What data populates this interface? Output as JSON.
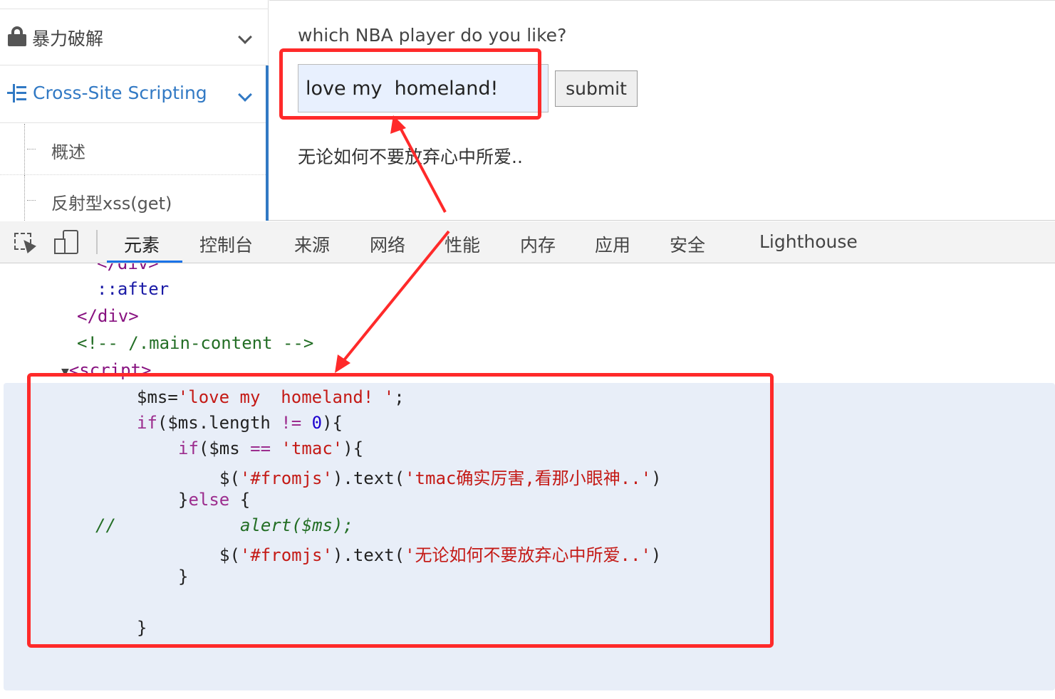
{
  "sidebar": {
    "items": [
      {
        "label": "暴力破解",
        "icon": "lock-icon"
      },
      {
        "label": "Cross-Site Scripting",
        "icon": "tree-indent-icon"
      }
    ],
    "sub_items": [
      {
        "label": "概述"
      },
      {
        "label": "反射型xss(get)"
      }
    ]
  },
  "main": {
    "question": "which NBA player do you like?",
    "input_value": "love my  homeland!",
    "submit_label": "submit",
    "result_text": "无论如何不要放弃心中所爱.."
  },
  "devtools": {
    "tabs": [
      "元素",
      "控制台",
      "来源",
      "网络",
      "性能",
      "内存",
      "应用",
      "安全",
      "Lighthouse"
    ],
    "active_tab": "元素",
    "dom_lines": [
      "</div>",
      "::after",
      "</div>",
      "<!-- /.main-content -->",
      "<script>"
    ],
    "script_code": {
      "line1_var": "$ms=",
      "line1_str": "'love my  homeland! '",
      "line1_end": ";",
      "line2_kw": "if",
      "line2_a": "($ms.length ",
      "line2_op": "!=",
      "line2_num": "0",
      "line2_b": "){",
      "line3_kw": "if",
      "line3_a": "($ms ",
      "line3_op": "==",
      "line3_str": "'tmac'",
      "line3_b": "){",
      "line4_a": "$(",
      "line4_sel": "'#fromjs'",
      "line4_b": ").text(",
      "line4_str": "'tmac确实厉害,看那小眼神..'",
      "line4_c": ")",
      "line5_a": "}",
      "line5_kw": "else",
      "line5_b": " {",
      "line6_comment": "//",
      "line6_alert": "alert($ms);",
      "line7_a": "$(",
      "line7_sel": "'#fromjs'",
      "line7_b": ").text(",
      "line7_str": "'无论如何不要放弃心中所爱..'",
      "line7_c": ")",
      "line8": "}",
      "line10": "}"
    }
  },
  "colors": {
    "accent": "#3179c4",
    "annotation": "#ff2a2a",
    "input_bg": "#e8f0fe",
    "script_bg": "#e8eef8"
  }
}
